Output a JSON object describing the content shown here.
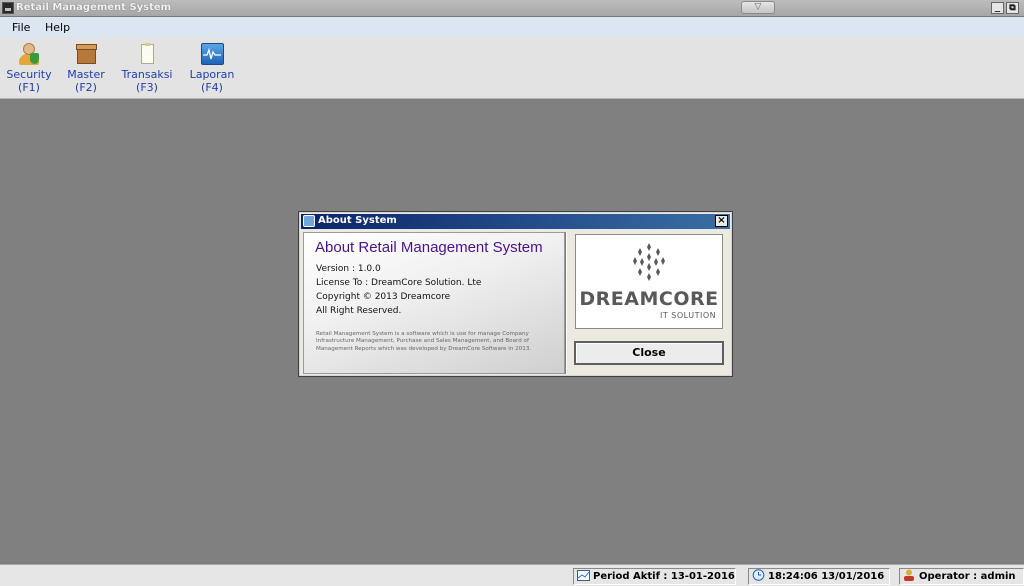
{
  "window": {
    "title": "Retail Management System",
    "minimize": "_",
    "restore": "⧉"
  },
  "menu": {
    "items": [
      "File",
      "Help"
    ]
  },
  "toolbar": {
    "items": [
      {
        "label": "Security",
        "key": "(F1)",
        "icon": "user-security-icon"
      },
      {
        "label": "Master",
        "key": "(F2)",
        "icon": "box-icon"
      },
      {
        "label": "Transaksi",
        "key": "(F3)",
        "icon": "clipboard-icon"
      },
      {
        "label": "Laporan",
        "key": "(F4)",
        "icon": "report-monitor-icon"
      }
    ]
  },
  "dialog": {
    "title": "About System",
    "close_x": "×",
    "heading": "About Retail Management System",
    "version": "Version : 1.0.0",
    "license": "License To : DreamCore Solution. Lte",
    "copyright": "Copyright © 2013 Dreamcore",
    "rights": "All Right Reserved.",
    "description": "Retail Management System is a software which is use for manage Company Infrastructure Management, Purchase and Sales Management, and Board of Management Reports which was developed by DreamCore Software in 2013.",
    "logo_text": "DREAMCORE",
    "logo_sub": "IT SOLUTION",
    "close_label": "Close"
  },
  "status": {
    "period": "Period Aktif : 13-01-2016",
    "datetime": "18:24:06 13/01/2016",
    "operator": "Operator : admin"
  },
  "colors": {
    "heading": "#4b128a",
    "toolbar_text": "#1f3fa8",
    "desktop": "#808080",
    "dialog_title": "#0a246a"
  }
}
